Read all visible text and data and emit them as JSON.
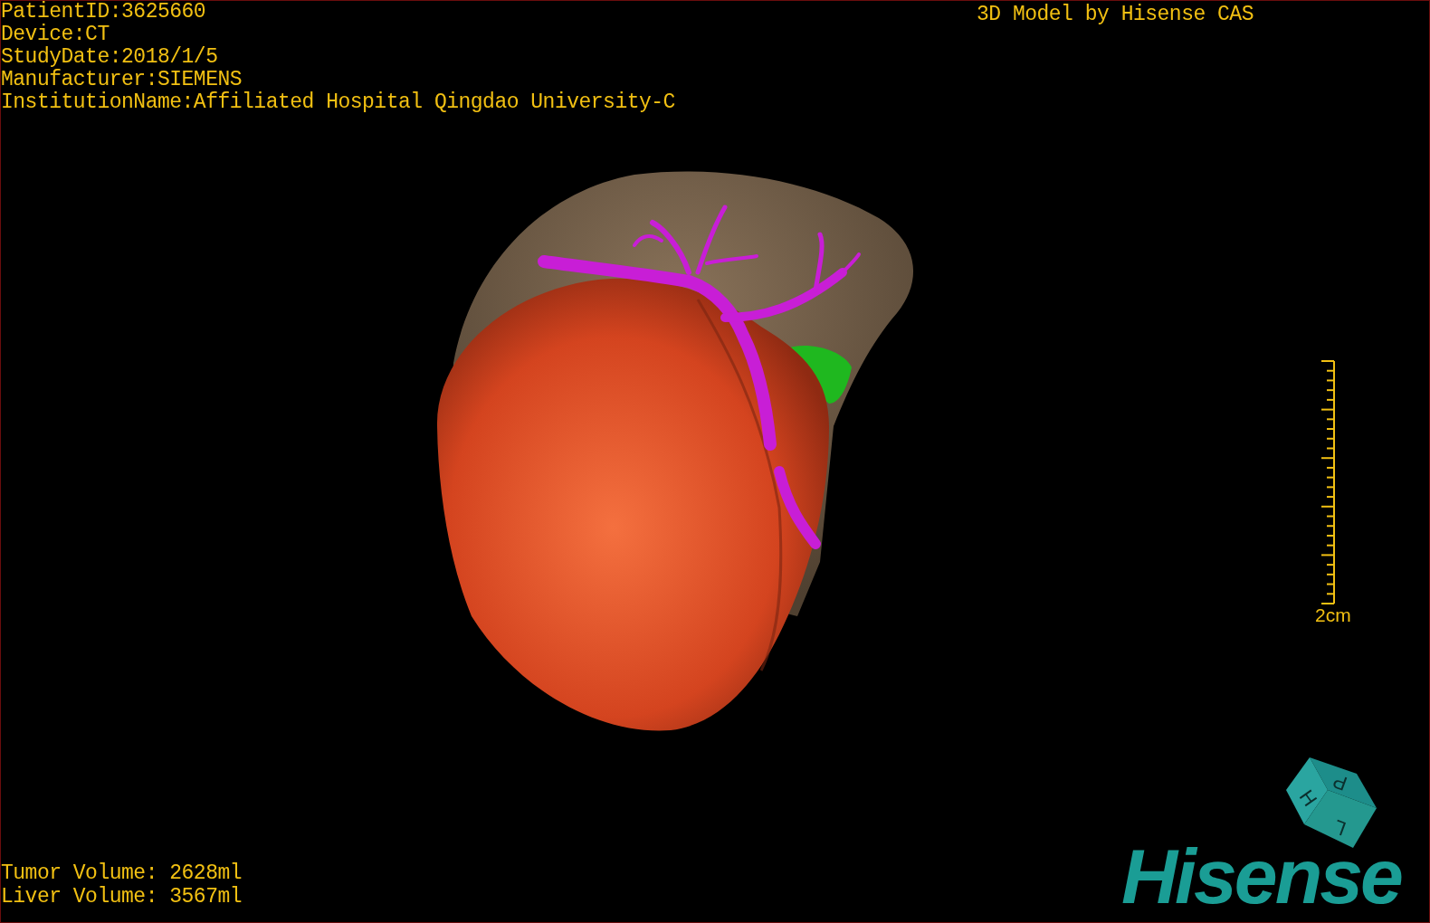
{
  "patient_info": [
    "PatientID:3625660",
    "Device:CT",
    "StudyDate:2018/1/5",
    "Manufacturer:SIEMENS",
    "InstitutionName:Affiliated Hospital Qingdao University-C"
  ],
  "model_credit": "3D Model by Hisense CAS",
  "scale_bar": {
    "label": "2cm"
  },
  "orientation_cube": {
    "labels": [
      "H",
      "P",
      "L"
    ]
  },
  "volumes": [
    "Tumor Volume: 2628ml",
    "Liver Volume: 3567ml"
  ],
  "logo": "Hisense"
}
